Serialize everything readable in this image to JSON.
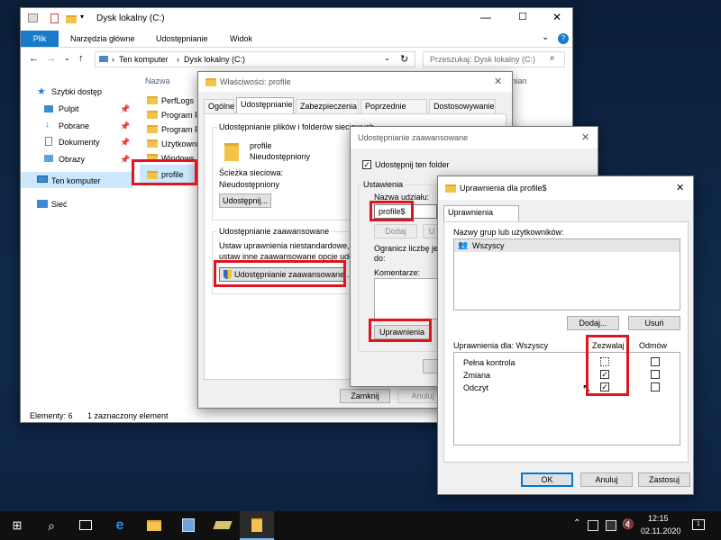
{
  "explorer": {
    "title": "Dysk lokalny (C:)",
    "ribbon_tabs": [
      "Plik",
      "Narzędzia główne",
      "Udostępnianie",
      "Widok"
    ],
    "address": [
      "Ten komputer",
      "Dysk lokalny (C:)"
    ],
    "search_placeholder": "Przeszukaj: Dysk lokalny (C:)",
    "col_name": "Nazwa",
    "col_modified_partial": "mian",
    "nav": {
      "quick_access": "Szybki dostęp",
      "items": [
        "Pulpit",
        "Pobrane",
        "Dokumenty",
        "Obrazy"
      ],
      "this_pc": "Ten komputer",
      "network": "Sieć"
    },
    "files": [
      "PerfLogs",
      "Program F",
      "Program F",
      "Użytkowni",
      "Windows",
      "profile"
    ],
    "status_count": "Elementy: 6",
    "status_selected": "1 zaznaczony element"
  },
  "props": {
    "title": "Właściwości: profile",
    "tabs": [
      "Ogólne",
      "Udostępnianie",
      "Zabezpieczenia",
      "Poprzednie wersje",
      "Dostosowywanie"
    ],
    "group1_title": "Udostępnianie plików i folderów sieciowych",
    "folder_name": "profile",
    "folder_state": "Nieudostępniony",
    "path_label": "Ścieżka sieciowa:",
    "path_value": "Nieudostępniony",
    "share_button": "Udostępnij...",
    "group2_title": "Udostępnianie zaawansowane",
    "adv_desc_1": "Ustaw uprawnienia niestandardowe, utw",
    "adv_desc_2": "ustaw inne zaawansowane opcje udost",
    "adv_button": "Udostępnianie zaawansowane...",
    "close_button": "Zamknij",
    "cancel_button": "Anuluj"
  },
  "adv": {
    "title": "Udostępnianie zaawansowane",
    "share_checkbox": "Udostępnij ten folder",
    "settings": "Ustawienia",
    "share_name_label": "Nazwa udziału:",
    "share_name_value": "profile$",
    "add_button": "Dodaj",
    "remove_button_partial": "U",
    "limit_text_1": "Ogranicz liczbę jed",
    "limit_text_2": "do:",
    "comment_label": "Komentarze:",
    "permissions_button": "Uprawnienia"
  },
  "perms": {
    "title": "Uprawnienia dla profile$",
    "tab": "Uprawnienia udziału",
    "groups_label": "Nazwy grup lub użytkowników:",
    "groups": [
      "Wszyscy"
    ],
    "add_button": "Dodaj...",
    "remove_button": "Usuń",
    "perm_label": "Uprawnienia dla: Wszyscy",
    "allow_header": "Zezwalaj",
    "deny_header": "Odmów",
    "rows": [
      {
        "name": "Pełna kontrola",
        "allow": false,
        "deny": false
      },
      {
        "name": "Zmiana",
        "allow": true,
        "deny": false
      },
      {
        "name": "Odczyt",
        "allow": true,
        "deny": false
      }
    ],
    "ok_button": "OK",
    "cancel_button": "Anuluj",
    "apply_button": "Zastosuj"
  },
  "taskbar": {
    "time": "12:15",
    "date": "02.11.2020"
  },
  "colors": {
    "accent": "#1979ca",
    "highlight": "#e0141e",
    "taskbar": "#101010"
  }
}
